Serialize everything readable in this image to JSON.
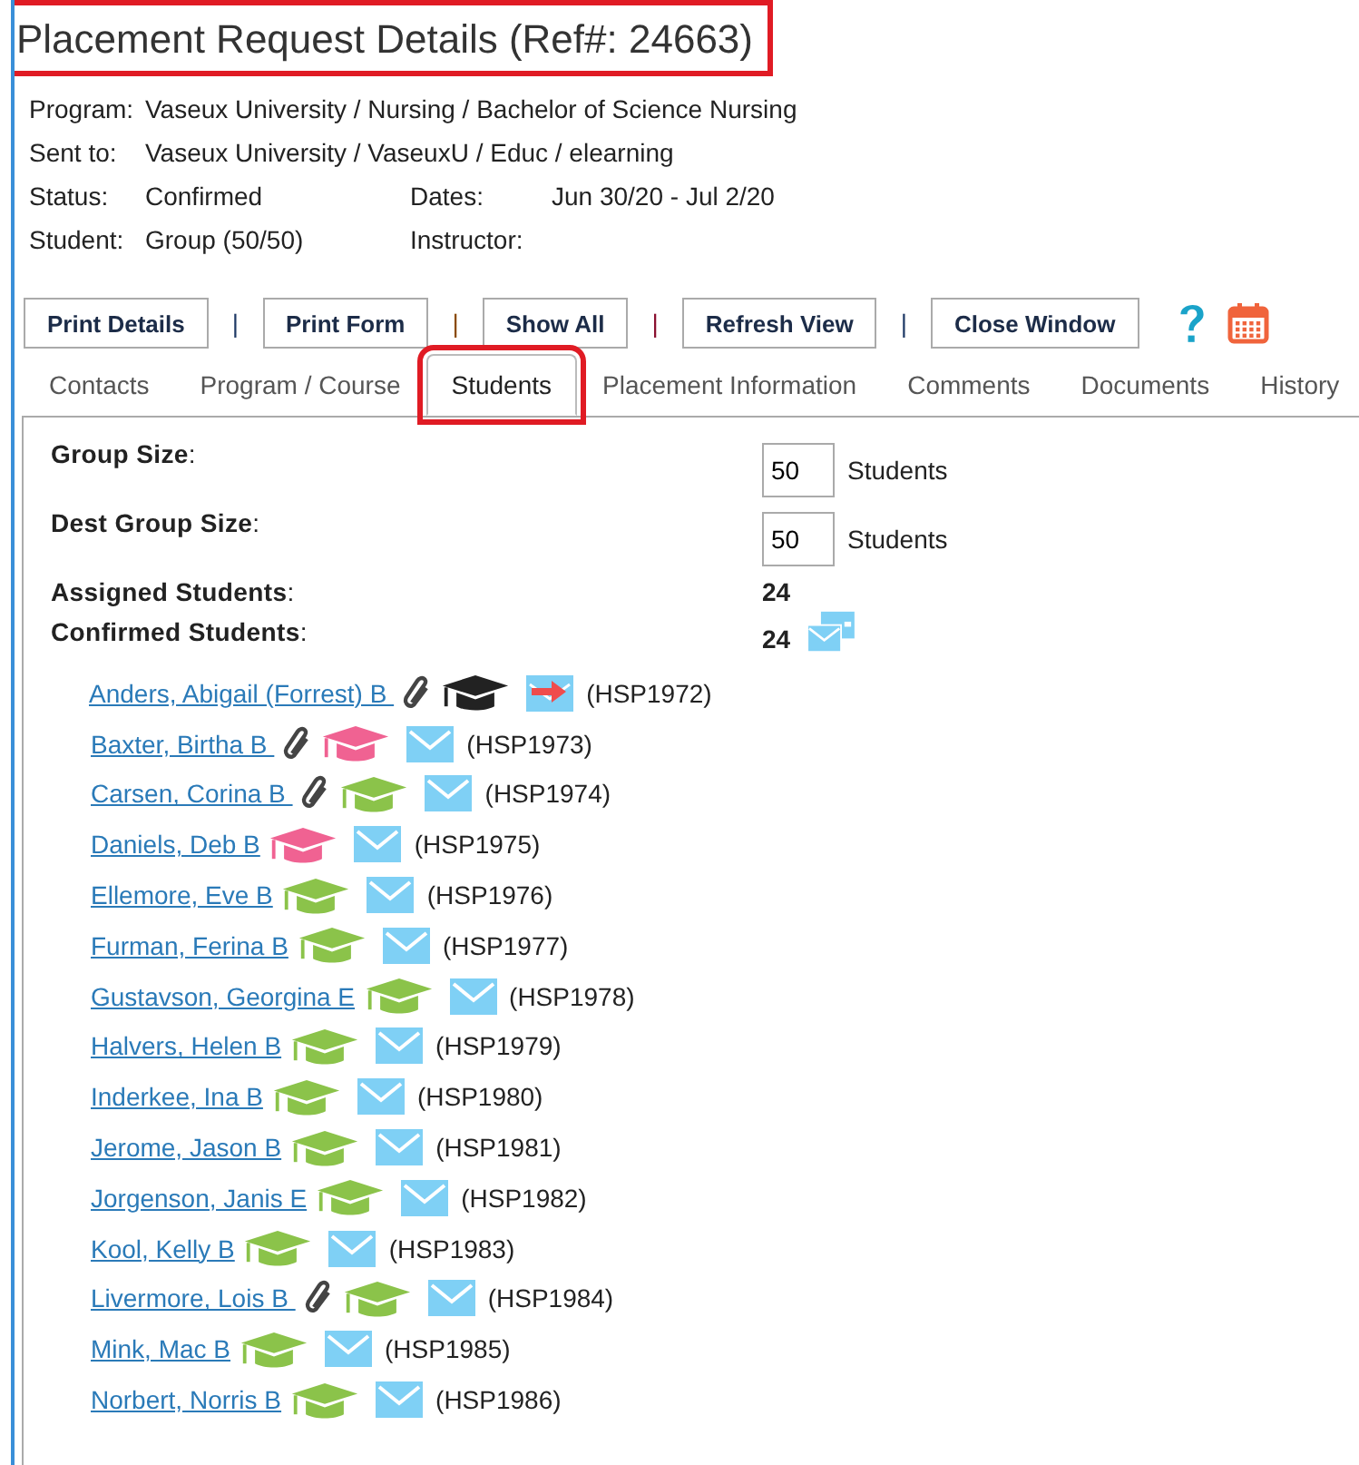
{
  "title": {
    "text": "Placement Request Details (Ref#: 24663)",
    "highlighted": true
  },
  "info": [
    {
      "label": "Program:",
      "value": "Vaseux University / Nursing / Bachelor of Science Nursing"
    },
    {
      "label": "Sent to:",
      "value": "Vaseux University / VaseuxU / Educ / elearning"
    },
    {
      "label": "Status:",
      "value": "Confirmed",
      "label2": "Dates:",
      "value2": "Jun 30/20 - Jul 2/20"
    },
    {
      "label": "Student:",
      "value": "Group (50/50)",
      "label2": "Instructor:"
    }
  ],
  "toolbar": [
    {
      "kind": "button",
      "label": "Print Details"
    },
    {
      "kind": "separator",
      "label": "|",
      "color": "#1f3a66"
    },
    {
      "kind": "button",
      "label": "Print Form"
    },
    {
      "kind": "separator",
      "label": "|",
      "color": "#8a4a00"
    },
    {
      "kind": "button",
      "label": "Show All"
    },
    {
      "kind": "separator",
      "label": "|",
      "color": "#8a1030"
    },
    {
      "kind": "button",
      "label": "Refresh View"
    },
    {
      "kind": "separator",
      "label": "|",
      "color": "#1f3a66"
    },
    {
      "kind": "button",
      "label": "Close Window"
    },
    {
      "kind": "help"
    },
    {
      "kind": "calendar"
    }
  ],
  "tabs": [
    {
      "label": "Contacts",
      "selected": false,
      "highlighted": false
    },
    {
      "label": "Program / Course",
      "selected": false,
      "highlighted": false
    },
    {
      "label": "Students",
      "selected": true,
      "highlighted": true
    },
    {
      "label": "Placement Information",
      "selected": false,
      "highlighted": false
    },
    {
      "label": "Comments",
      "selected": false,
      "highlighted": false
    },
    {
      "label": "Documents",
      "selected": false,
      "highlighted": false
    },
    {
      "label": "History",
      "selected": false,
      "highlighted": false
    }
  ],
  "sizes": [
    {
      "label": "Group Size",
      "colon": ":",
      "value": "50",
      "unit": "Students"
    },
    {
      "label": "Dest Group Size",
      "colon": ":",
      "value": "50",
      "unit": "Students"
    }
  ],
  "counts": [
    {
      "label": "Assigned Students",
      "colon": ":",
      "value": "24",
      "mail": false
    },
    {
      "label": "Confirmed Students",
      "colon": ":",
      "value": "24",
      "mail": true
    }
  ],
  "students": [
    {
      "name": "Anders, Abigail (Forrest) B ",
      "attachment": true,
      "color": "#222222",
      "kind": "forward",
      "code": "(HSP1972)"
    },
    {
      "name": "Baxter, Birtha B ",
      "attachment": true,
      "color": "#f06292",
      "kind": "plain",
      "code": "(HSP1973)"
    },
    {
      "name": "Carsen, Corina B ",
      "attachment": true,
      "color": "#8bc34a",
      "kind": "plain",
      "code": "(HSP1974)"
    },
    {
      "name": "Daniels, Deb B",
      "attachment": false,
      "color": "#f06292",
      "kind": "plain",
      "code": "(HSP1975)"
    },
    {
      "name": "Ellemore, Eve B",
      "attachment": false,
      "color": "#8bc34a",
      "kind": "plain",
      "code": "(HSP1976)"
    },
    {
      "name": "Furman, Ferina B",
      "attachment": false,
      "color": "#8bc34a",
      "kind": "plain",
      "code": "(HSP1977)"
    },
    {
      "name": "Gustavson, Georgina E",
      "attachment": false,
      "color": "#8bc34a",
      "kind": "plain",
      "code": "(HSP1978)"
    },
    {
      "name": "Halvers, Helen B",
      "attachment": false,
      "color": "#8bc34a",
      "kind": "plain",
      "code": "(HSP1979)"
    },
    {
      "name": "Inderkee, Ina B",
      "attachment": false,
      "color": "#8bc34a",
      "kind": "plain",
      "code": "(HSP1980)"
    },
    {
      "name": "Jerome, Jason B",
      "attachment": false,
      "color": "#8bc34a",
      "kind": "plain",
      "code": "(HSP1981)"
    },
    {
      "name": "Jorgenson, Janis E",
      "attachment": false,
      "color": "#8bc34a",
      "kind": "plain",
      "code": "(HSP1982)"
    },
    {
      "name": "Kool, Kelly B",
      "attachment": false,
      "color": "#8bc34a",
      "kind": "plain",
      "code": "(HSP1983)"
    },
    {
      "name": "Livermore, Lois B ",
      "attachment": true,
      "color": "#8bc34a",
      "kind": "plain",
      "code": "(HSP1984)"
    },
    {
      "name": "Mink, Mac B",
      "attachment": false,
      "color": "#8bc34a",
      "kind": "plain",
      "code": "(HSP1985)"
    },
    {
      "name": "Norbert, Norris B",
      "attachment": false,
      "color": "#8bc34a",
      "kind": "plain",
      "code": "(HSP1986)"
    }
  ]
}
